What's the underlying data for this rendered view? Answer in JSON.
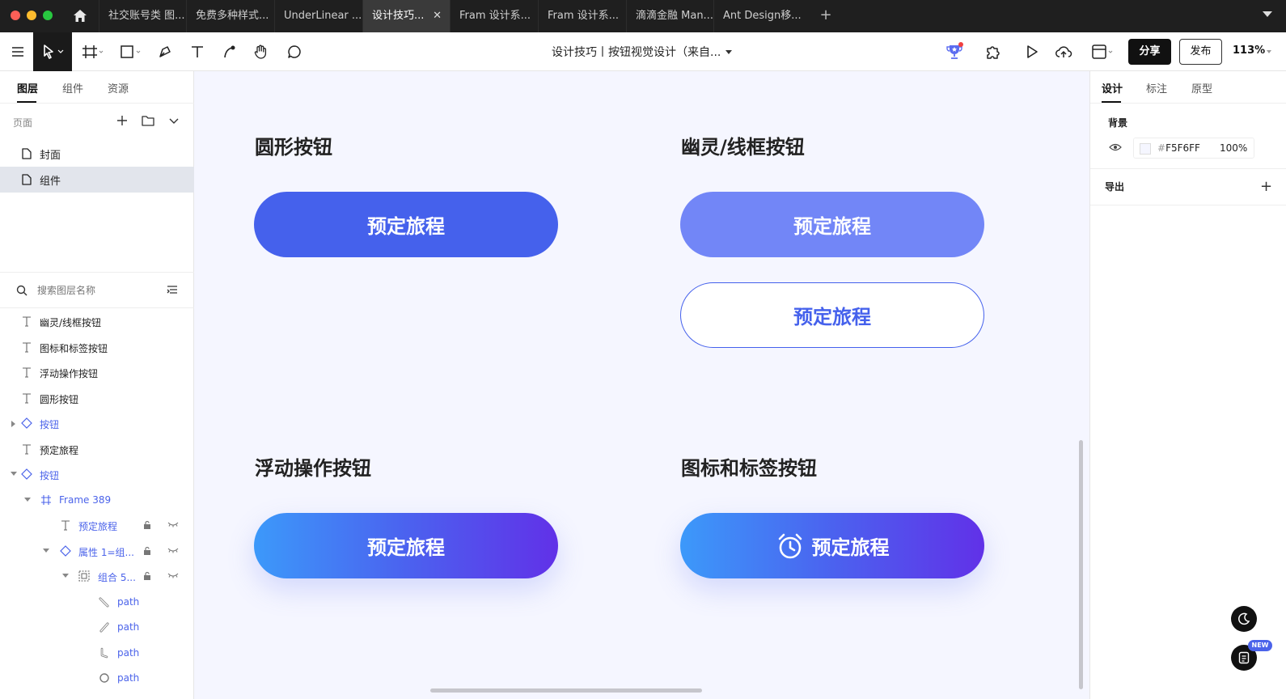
{
  "tabs": [
    {
      "label": "社交账号类 图...",
      "active": false
    },
    {
      "label": "免费多种样式...",
      "active": false
    },
    {
      "label": "UnderLinear ...",
      "active": false
    },
    {
      "label": "设计技巧...",
      "active": true
    },
    {
      "label": "Fram 设计系...",
      "active": false
    },
    {
      "label": "Fram 设计系...",
      "active": false
    },
    {
      "label": "滴滴金融 Man...",
      "active": false
    },
    {
      "label": "Ant Design移...",
      "active": false
    }
  ],
  "toolbar": {
    "doc_title": "设计技巧丨按钮视觉设计（来自...",
    "share_label": "分享",
    "publish_label": "发布",
    "zoom": "113%"
  },
  "left_panel": {
    "tabs": [
      "图层",
      "组件",
      "资源"
    ],
    "pages_label": "页面",
    "pages": [
      {
        "label": "封面",
        "selected": false
      },
      {
        "label": "组件",
        "selected": true
      }
    ],
    "search_placeholder": "搜索图层名称",
    "layers": [
      {
        "label": "幽灵/线框按钮",
        "type": "text",
        "indent": 0
      },
      {
        "label": "图标和标签按钮",
        "type": "text",
        "indent": 0
      },
      {
        "label": "浮动操作按钮",
        "type": "text",
        "indent": 0
      },
      {
        "label": "圆形按钮",
        "type": "text",
        "indent": 0
      },
      {
        "label": "按钮",
        "type": "component",
        "indent": 0,
        "arrow": "right"
      },
      {
        "label": "预定旅程",
        "type": "text",
        "indent": 0
      },
      {
        "label": "按钮",
        "type": "component",
        "indent": 0,
        "arrow": "down"
      },
      {
        "label": "Frame 389",
        "type": "frame",
        "indent": 1,
        "arrow": "down"
      },
      {
        "label": "预定旅程",
        "type": "text",
        "indent": 2
      },
      {
        "label": "属性 1=组...",
        "type": "component",
        "indent": 2,
        "arrow": "down"
      },
      {
        "label": "组合 5...",
        "type": "group",
        "indent": 3,
        "arrow": "down"
      },
      {
        "label": "path",
        "type": "path",
        "indent": 4
      },
      {
        "label": "path",
        "type": "path",
        "indent": 4
      },
      {
        "label": "path",
        "type": "path",
        "indent": 4
      },
      {
        "label": "path",
        "type": "ellipse",
        "indent": 4
      }
    ]
  },
  "canvas": {
    "background": "#F5F6FF",
    "sections": {
      "round": {
        "title": "圆形按钮",
        "button": "预定旅程"
      },
      "ghost": {
        "title": "幽灵/线框按钮",
        "button_filled": "预定旅程",
        "button_outline": "预定旅程"
      },
      "fab": {
        "title": "浮动操作按钮",
        "button": "预定旅程"
      },
      "icon_label": {
        "title": "图标和标签按钮",
        "button": "预定旅程",
        "icon": "alarm-clock-icon"
      }
    }
  },
  "right_panel": {
    "tabs": [
      "设计",
      "标注",
      "原型"
    ],
    "background_label": "背景",
    "bg_hex": "F5F6FF",
    "bg_hash": "#",
    "bg_opacity": "100%",
    "export_label": "导出",
    "new_badge": "NEW"
  },
  "colors": {
    "accent": "#4561EC",
    "accent_light": "#7286F7",
    "gradient_start": "#3C99FA",
    "gradient_end": "#6131E8"
  }
}
